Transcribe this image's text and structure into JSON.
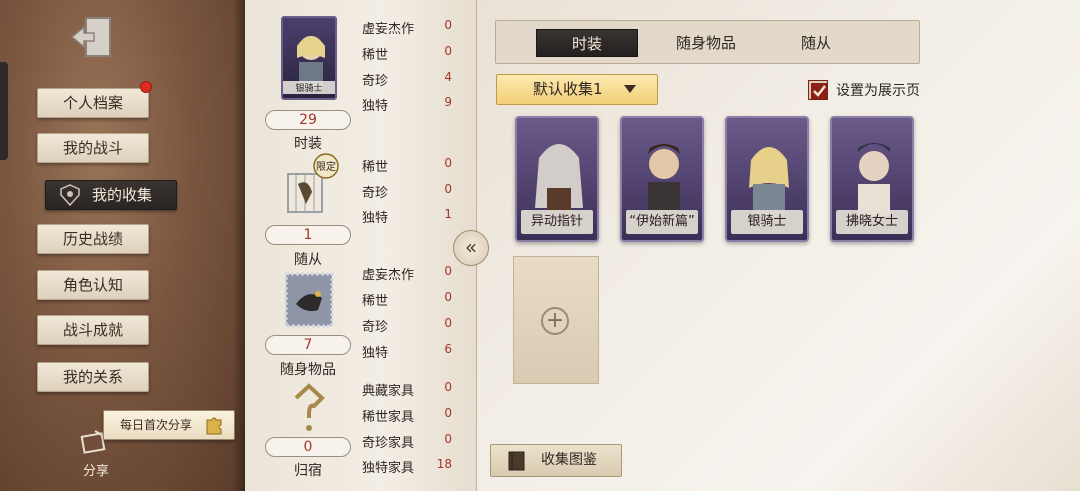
{
  "sidebar": {
    "menu": [
      {
        "label": "个人档案",
        "active": false,
        "has_badge": true
      },
      {
        "label": "我的战斗",
        "active": false
      },
      {
        "label": "我的收集",
        "active": true
      },
      {
        "label": "历史战绩",
        "active": false
      },
      {
        "label": "角色认知",
        "active": false
      },
      {
        "label": "战斗成就",
        "active": false
      },
      {
        "label": "我的关系",
        "active": false
      }
    ],
    "share_banner": "每日首次分享",
    "share_label": "分享"
  },
  "stats": {
    "costume": {
      "thumb_label": "银骑士",
      "count": "29",
      "label": "时装",
      "rows": [
        {
          "name": "虚妄杰作",
          "value": "0"
        },
        {
          "name": "稀世",
          "value": "0"
        },
        {
          "name": "奇珍",
          "value": "4"
        },
        {
          "name": "独特",
          "value": "9"
        }
      ]
    },
    "follower": {
      "badge": "限定",
      "count": "1",
      "label": "随从",
      "rows": [
        {
          "name": "稀世",
          "value": "0"
        },
        {
          "name": "奇珍",
          "value": "0"
        },
        {
          "name": "独特",
          "value": "1"
        }
      ]
    },
    "accessory": {
      "count": "7",
      "label": "随身物品",
      "rows": [
        {
          "name": "虚妄杰作",
          "value": "0"
        },
        {
          "name": "稀世",
          "value": "0"
        },
        {
          "name": "奇珍",
          "value": "0"
        },
        {
          "name": "独特",
          "value": "6"
        }
      ]
    },
    "home": {
      "count": "0",
      "label": "归宿",
      "rows": [
        {
          "name": "典藏家具",
          "value": "0"
        },
        {
          "name": "稀世家具",
          "value": "0"
        },
        {
          "name": "奇珍家具",
          "value": "0"
        },
        {
          "name": "独特家具",
          "value": "18"
        }
      ]
    }
  },
  "main": {
    "tabs": [
      {
        "label": "时装",
        "active": true
      },
      {
        "label": "随身物品",
        "active": false
      },
      {
        "label": "随从",
        "active": false
      }
    ],
    "dropdown_value": "默认收集1",
    "showcase_checkbox_label": "设置为展示页",
    "showcase_checked": true,
    "cards": [
      {
        "name": "异动指针"
      },
      {
        "name": "“伊始新篇”"
      },
      {
        "name": "银骑士"
      },
      {
        "name": "拂晓女士"
      }
    ],
    "guide_button": "收集图鉴"
  },
  "collapse_glyph": "«",
  "colors": {
    "accent_red": "#a1362c",
    "dark_button": "#2a2524",
    "dropdown_gold": "#f3cf79",
    "card_purple": "#3b2f57"
  }
}
